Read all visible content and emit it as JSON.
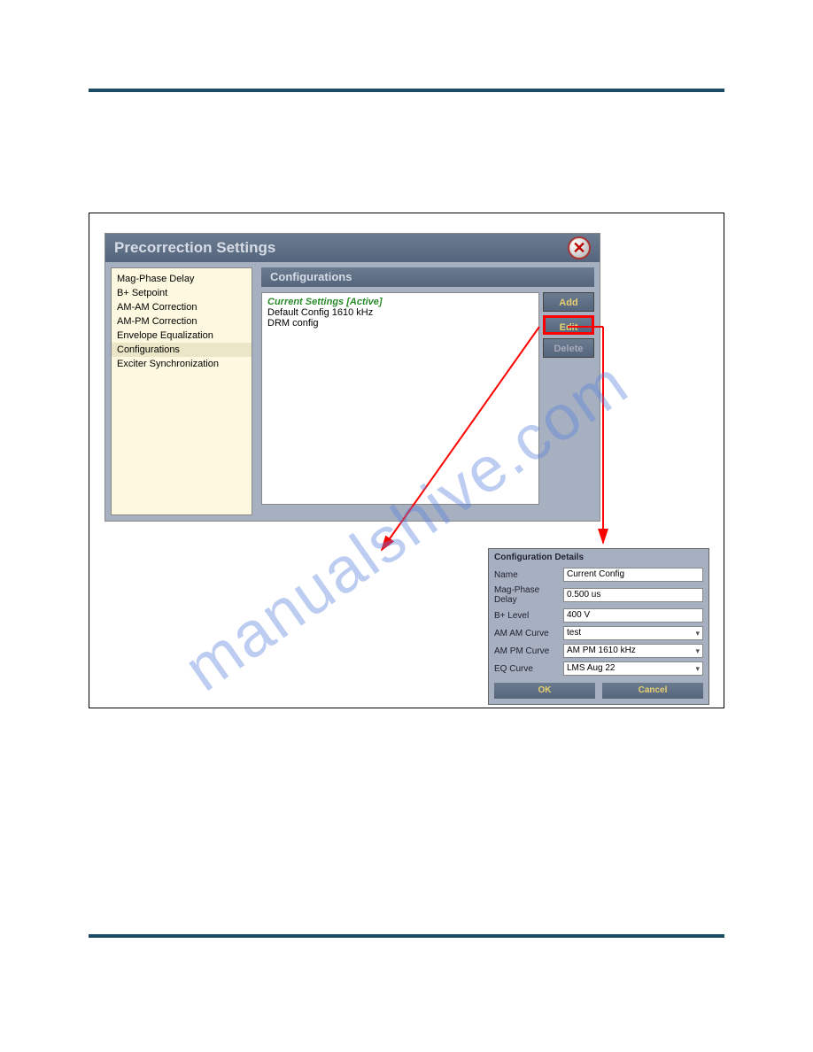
{
  "watermark": "manualshive.com",
  "window": {
    "title": "Precorrection Settings",
    "panel_title": "Configurations"
  },
  "sidebar": {
    "items": [
      "Mag-Phase Delay",
      "B+ Setpoint",
      "AM-AM Correction",
      "AM-PM Correction",
      "Envelope Equalization",
      "Configurations",
      "Exciter Synchronization"
    ],
    "selected_index": 5
  },
  "config_list": {
    "active": "Current Settings [Active]",
    "items": [
      "Default Config 1610 kHz",
      "DRM config"
    ]
  },
  "buttons": {
    "add": "Add",
    "edit": "Edit",
    "delete": "Delete"
  },
  "details": {
    "title": "Configuration Details",
    "rows": [
      {
        "label": "Name",
        "value": "Current Config",
        "select": false
      },
      {
        "label": "Mag-Phase Delay",
        "value": "0.500 us",
        "select": false
      },
      {
        "label": "B+ Level",
        "value": "400 V",
        "select": false
      },
      {
        "label": "AM AM Curve",
        "value": "test",
        "select": true
      },
      {
        "label": "AM PM Curve",
        "value": "AM PM 1610 kHz",
        "select": true
      },
      {
        "label": "EQ Curve",
        "value": "LMS Aug 22",
        "select": true
      }
    ],
    "ok": "OK",
    "cancel": "Cancel"
  }
}
